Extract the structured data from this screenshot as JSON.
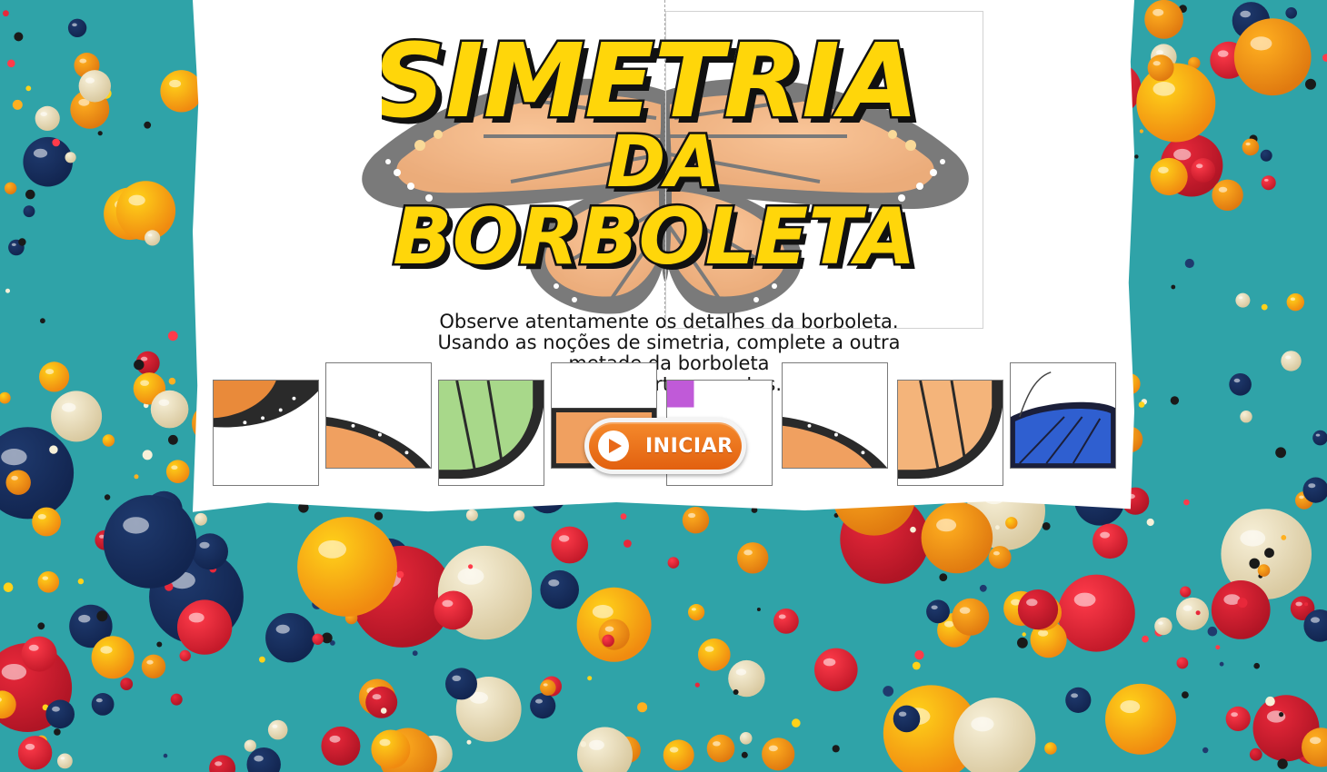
{
  "title": {
    "line1": "SIMETRIA",
    "line2": "DA",
    "line3": "BORBOLETA"
  },
  "instructions": {
    "line1": "Observe atentamente os detalhes da borboleta.",
    "line2": "Usando as noções de simetria,  complete a outra",
    "line3": "metade da borboleta",
    "line4": "com as partes corretas."
  },
  "start_button": {
    "label": "INICIAR",
    "icon": "play-icon"
  },
  "pieces": [
    {
      "name": "piece-orange-upper-wing",
      "color": "#e98a3a"
    },
    {
      "name": "piece-orange-lower-edge",
      "color": "#f0a060"
    },
    {
      "name": "piece-green-wing",
      "color": "#a8d88a"
    },
    {
      "name": "piece-orange-wing-partial",
      "color": "#f0a060"
    },
    {
      "name": "piece-purple-wing-partial",
      "color": "#c05ad8"
    },
    {
      "name": "piece-orange-lower-edge-2",
      "color": "#f0a060"
    },
    {
      "name": "piece-orange-wing-full",
      "color": "#f4b47a"
    },
    {
      "name": "piece-blue-wing",
      "color": "#2f5fd0"
    }
  ],
  "colors": {
    "background": "#2fa3a8",
    "title_fill": "#ffd60a",
    "title_outline": "#111111",
    "button_orange": "#e8691a"
  }
}
